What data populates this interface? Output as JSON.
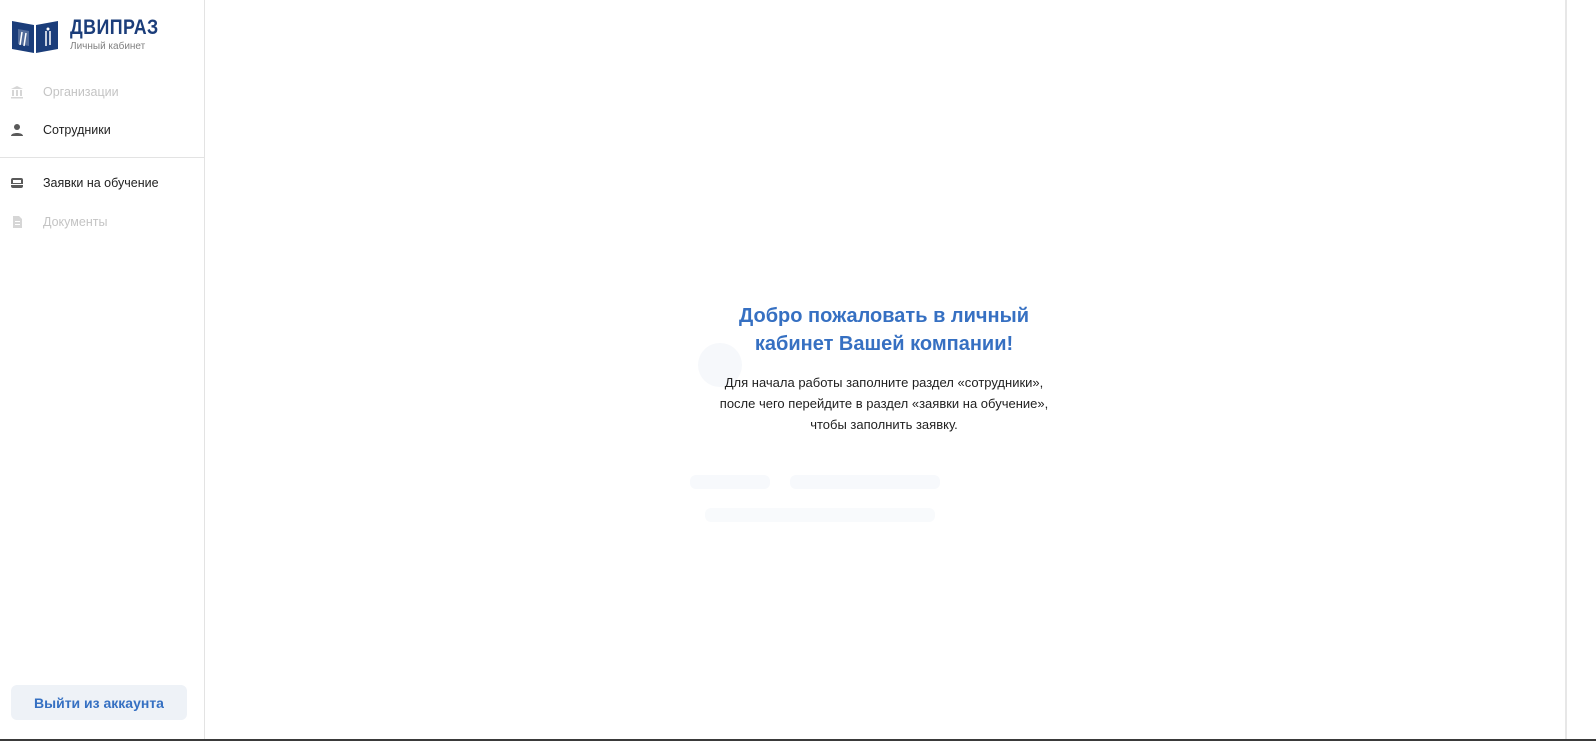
{
  "brand": {
    "title": "ДВИПРАЗ",
    "subtitle": "Личный кабинет",
    "color": "#1b3d7a"
  },
  "sidebar": {
    "items": [
      {
        "label": "Организации",
        "icon": "bank-icon",
        "state": "disabled"
      },
      {
        "label": "Сотрудники",
        "icon": "person-icon",
        "state": "active"
      },
      {
        "label": "Заявки на обучение",
        "icon": "inbox-icon",
        "state": "active"
      },
      {
        "label": "Документы",
        "icon": "document-icon",
        "state": "disabled"
      }
    ],
    "logout_label": "Выйти из аккаунта"
  },
  "main": {
    "welcome_title": "Добро пожаловать в личный кабинет Вашей компании!",
    "welcome_text": "Для начала работы заполните раздел «сотрудники», после чего перейдите в раздел «заявки на обучение», чтобы заполнить заявку."
  },
  "colors": {
    "accent": "#3670c2",
    "disabled_text": "#c4c4c4",
    "button_bg": "#eef2f7"
  }
}
